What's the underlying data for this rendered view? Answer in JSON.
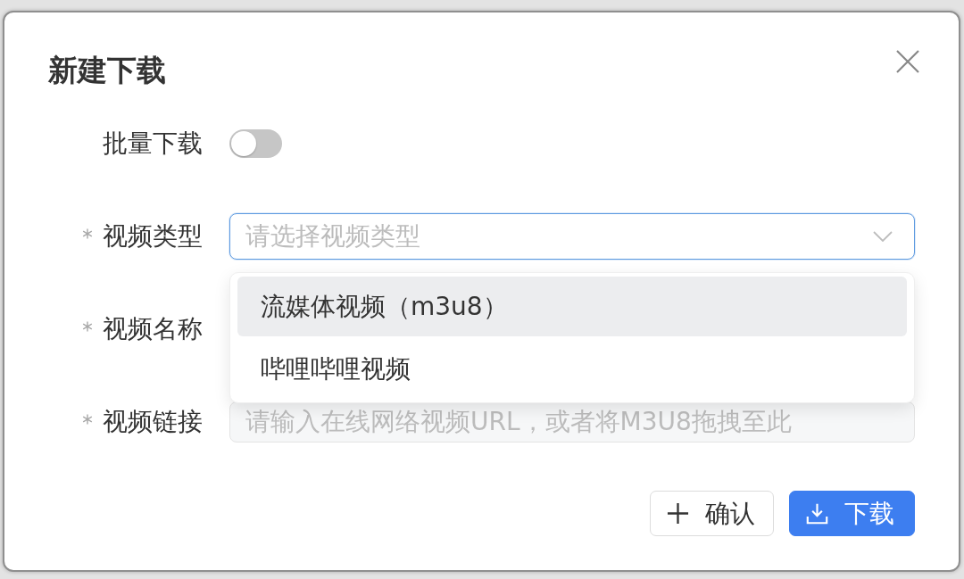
{
  "dialog": {
    "title": "新建下载",
    "form": {
      "fields": [
        {
          "kind": "switch",
          "label": "批量下载",
          "required": false,
          "on": false
        },
        {
          "kind": "select",
          "label": "视频类型",
          "required": true,
          "placeholder": "请选择视频类型",
          "expanded": true,
          "options": [
            {
              "label": "流媒体视频（m3u8）",
              "selected": false,
              "hovered": true
            },
            {
              "label": "哔哩哔哩视频",
              "selected": false,
              "hovered": false
            }
          ]
        },
        {
          "kind": "covered",
          "label": "视频名称",
          "required": true
        },
        {
          "kind": "input",
          "label": "视频链接",
          "required": true,
          "placeholder": "请输入在线网络视频URL，或者将M3U8拖拽至此",
          "disabled": true
        }
      ]
    },
    "buttons": [
      {
        "kind": "add",
        "label": "确认"
      },
      {
        "kind": "download",
        "label": "下载"
      }
    ]
  }
}
